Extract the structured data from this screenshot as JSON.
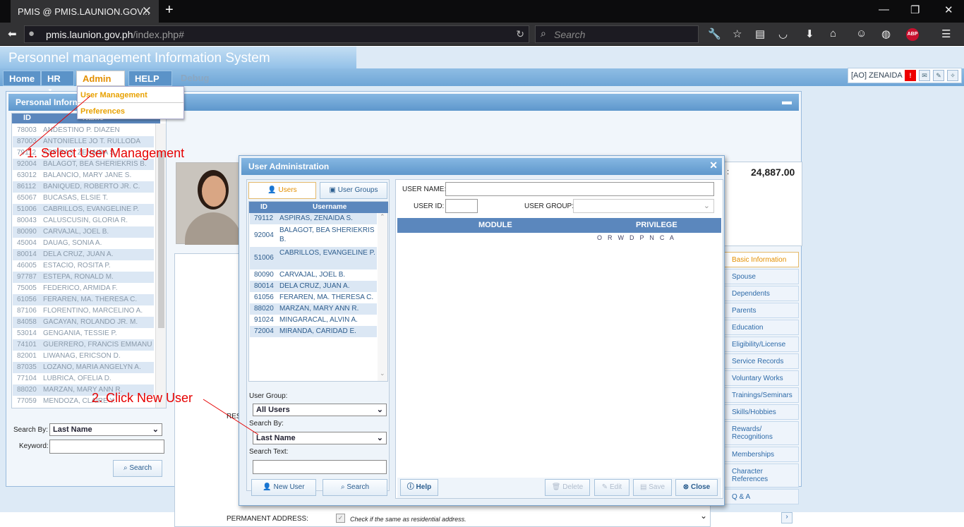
{
  "browser": {
    "tab_title": "PMIS @ PMIS.LAUNION.GOV...",
    "url_host": "pmis.launion.gov.ph",
    "url_path": "/index.php#",
    "search_placeholder": "Search",
    "ext_abp": "ABP"
  },
  "app": {
    "title": "Personnel management Information System",
    "menu": [
      "Home",
      "HR",
      "Admin",
      "HELP",
      "Debug"
    ],
    "user": "[AO] ZENAIDA",
    "admin_dropdown": [
      "User Management",
      "Preferences"
    ]
  },
  "main": {
    "panel_title": "Personal Inform",
    "list_columns": [
      "ID",
      "Name"
    ],
    "rows": [
      {
        "id": "78003",
        "name": "ANDESTINO P. DIAZEN"
      },
      {
        "id": "87003",
        "name": "ANTONIELLE JO T. RULLODA"
      },
      {
        "id": "79112",
        "name": "ASPIRAS, ZENAIDA S."
      },
      {
        "id": "92004",
        "name": "BALAGOT, BEA SHERIEKRIS B."
      },
      {
        "id": "63012",
        "name": "BALANCIO, MARY JANE S."
      },
      {
        "id": "86112",
        "name": "BANIQUED, ROBERTO JR. C."
      },
      {
        "id": "65067",
        "name": "BUCASAS, ELSIE T."
      },
      {
        "id": "51006",
        "name": "CABRILLOS, EVANGELINE P."
      },
      {
        "id": "80043",
        "name": "CALUSCUSIN, GLORIA R."
      },
      {
        "id": "80090",
        "name": "CARVAJAL, JOEL B."
      },
      {
        "id": "45004",
        "name": "DAUAG, SONIA A."
      },
      {
        "id": "80014",
        "name": "DELA CRUZ, JUAN A."
      },
      {
        "id": "46005",
        "name": "ESTACIO, ROSITA P."
      },
      {
        "id": "97787",
        "name": "ESTEPA, RONALD M."
      },
      {
        "id": "75005",
        "name": "FEDERICO, ARMIDA F."
      },
      {
        "id": "61056",
        "name": "FERAREN, MA. THERESA C."
      },
      {
        "id": "87106",
        "name": "FLORENTINO, MARCELINO A."
      },
      {
        "id": "84058",
        "name": "GACAYAN, ROLANDO JR. M."
      },
      {
        "id": "53014",
        "name": "GENGANIA, TESSIE P."
      },
      {
        "id": "74101",
        "name": "GUERRERO, FRANCIS EMMANU"
      },
      {
        "id": "82001",
        "name": "LIWANAG, ERICSON D."
      },
      {
        "id": "87035",
        "name": "LOZANO, MARIA ANGELYN A."
      },
      {
        "id": "77104",
        "name": "LUBRICA, OFELIA D."
      },
      {
        "id": "88020",
        "name": "MARZAN, MARY ANN R."
      },
      {
        "id": "77059",
        "name": "MENDOZA, CLAIRE Y."
      }
    ],
    "search_by_label": "Search By:",
    "search_by_value": "Last Name",
    "keyword_label": "Keyword:",
    "search_button": "Search",
    "salary": "24,887.00",
    "res_label": "RES",
    "permanent_address_label": "PERMANENT ADDRESS:",
    "same_address_note": "Check if the same as residential address.",
    "side_tabs": [
      "Basic Information",
      "Spouse",
      "Dependents",
      "Parents",
      "Education",
      "Eligibility/License",
      "Service Records",
      "Voluntary Works",
      "Trainings/Seminars",
      "Skills/Hobbies",
      "Rewards/ Recognitions",
      "Memberships",
      "Character References",
      "Q & A"
    ]
  },
  "dialog": {
    "title": "User Administration",
    "tabs": [
      "Users",
      "User Groups"
    ],
    "list_columns": [
      "ID",
      "Username"
    ],
    "users": [
      {
        "id": "79112",
        "name": "ASPIRAS, ZENAIDA S."
      },
      {
        "id": "92004",
        "name": "BALAGOT, BEA SHERIEKRIS B."
      },
      {
        "id": "51006",
        "name": "CABRILLOS, EVANGELINE P."
      },
      {
        "id": "80090",
        "name": "CARVAJAL, JOEL B."
      },
      {
        "id": "80014",
        "name": "DELA CRUZ, JUAN A."
      },
      {
        "id": "61056",
        "name": "FERAREN, MA. THERESA C."
      },
      {
        "id": "88020",
        "name": "MARZAN, MARY ANN R."
      },
      {
        "id": "91024",
        "name": "MINGARACAL, ALVIN A."
      },
      {
        "id": "72004",
        "name": "MIRANDA, CARIDAD E."
      }
    ],
    "user_group_label": "User Group:",
    "user_group_value": "All Users",
    "search_by_label": "Search By:",
    "search_by_value": "Last Name",
    "search_text_label": "Search Text:",
    "new_user_button": "New User",
    "search_button": "Search",
    "username_label": "USER NAME:",
    "userid_label": "USER ID:",
    "usergroup_label": "USER GROUP:",
    "module_header": "MODULE",
    "privilege_header": "PRIVILEGE",
    "privilege_cols": "O  R  W  D  P  N  C  A",
    "help_button": "Help",
    "delete_button": "Delete",
    "edit_button": "Edit",
    "save_button": "Save",
    "close_button": "Close"
  },
  "annotations": {
    "step1": "1. Select User Management",
    "step2": "2. Click New User"
  }
}
